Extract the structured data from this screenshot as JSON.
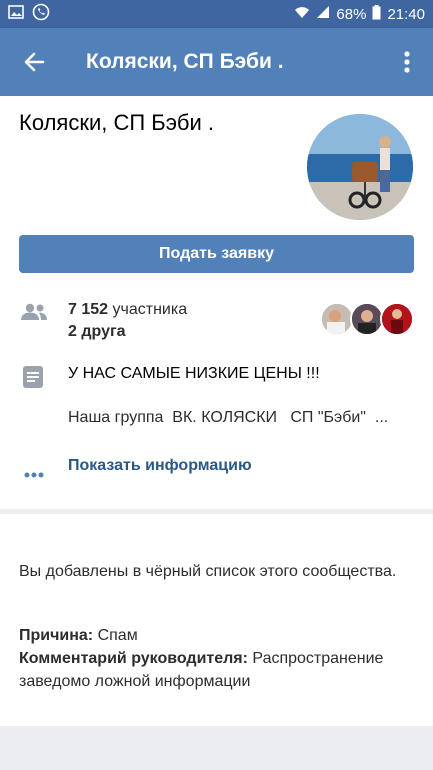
{
  "status_bar": {
    "battery": "68%",
    "time": "21:40"
  },
  "appbar": {
    "title": "Коляски, СП Бэби ."
  },
  "group": {
    "name": "Коляски, СП Бэби .",
    "join_button": "Подать заявку",
    "members_count": "7 152",
    "members_label": "участника",
    "friends_count": "2",
    "friends_label": "друга",
    "status": "У НАС САМЫЕ НИЗКИЕ ЦЕНЫ !!!",
    "description": "Наша группа  ВК. КОЛЯСКИ   СП \"Бэби\"  ...",
    "show_info": "Показать информацию"
  },
  "blacklist": {
    "message": "Вы добавлены в чёрный список этого сообщества.",
    "reason_label": "Причина:",
    "reason_value": "Спам",
    "comment_label": "Комментарий руководителя:",
    "comment_value": "Распространение заведомо ложной информации"
  },
  "colors": {
    "header": "#5181b8",
    "statusbar": "#3f66a0",
    "link": "#2a5885",
    "icon_gray": "#99a2ad"
  }
}
